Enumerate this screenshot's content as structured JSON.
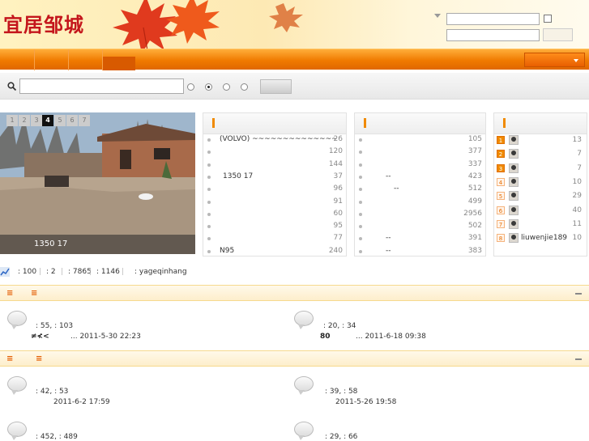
{
  "header": {
    "logo_text": "宜居邹城"
  },
  "slideshow": {
    "tabs": [
      "1",
      "2",
      "3",
      "4",
      "5",
      "6",
      "7"
    ],
    "active_tab": "4",
    "caption": "1350 17"
  },
  "panel1": {
    "rows": [
      {
        "t": "(VOLVO) ~~~~~~~~~~~~~~",
        "n": "26"
      },
      {
        "t": "",
        "n": "120"
      },
      {
        "t": "",
        "n": "144"
      },
      {
        "t": "1350 17",
        "n": "37"
      },
      {
        "t": "",
        "n": "96"
      },
      {
        "t": "",
        "n": "91"
      },
      {
        "t": "",
        "n": "60"
      },
      {
        "t": "",
        "n": "95"
      },
      {
        "t": "",
        "n": "77"
      },
      {
        "t": "N95",
        "n": "240"
      }
    ]
  },
  "panel2": {
    "rows": [
      {
        "t": "",
        "n": "105"
      },
      {
        "t": "",
        "n": "377"
      },
      {
        "t": "",
        "n": "337"
      },
      {
        "t": "--",
        "n": "423"
      },
      {
        "t": "--",
        "n": "512"
      },
      {
        "t": "",
        "n": "499"
      },
      {
        "t": "",
        "n": "2956"
      },
      {
        "t": "",
        "n": "502"
      },
      {
        "t": "--",
        "n": "391"
      },
      {
        "t": "--",
        "n": "383"
      }
    ]
  },
  "panel3": {
    "rows": [
      {
        "rank": "1",
        "name": "",
        "n": "13"
      },
      {
        "rank": "2",
        "name": "",
        "n": "7"
      },
      {
        "rank": "3",
        "name": "",
        "n": "7"
      },
      {
        "rank": "4",
        "name": "",
        "n": "10"
      },
      {
        "rank": "5",
        "name": "",
        "n": "29"
      },
      {
        "rank": "6",
        "name": "",
        "n": "40"
      },
      {
        "rank": "7",
        "name": "",
        "n": "11"
      },
      {
        "rank": "8",
        "name": "liuwenjie189",
        "n": "10"
      }
    ]
  },
  "stats": {
    "items": [
      ": 100",
      ": 2",
      ": 7865",
      ": 1146",
      ": yageqinhang"
    ]
  },
  "sections": [
    {
      "posts": [
        {
          "counts": ": 55,  : 103",
          "sub": "≠≮<",
          "date": "... 2011-5-30 22:23"
        },
        {
          "counts": ": 20,  : 34",
          "sub": "80",
          "date": "... 2011-6-18 09:38"
        }
      ]
    },
    {
      "posts": [
        {
          "counts": ": 42,  : 53",
          "sub": "",
          "date": "2011-6-2 17:59"
        },
        {
          "counts": ": 39,  : 58",
          "sub": "",
          "date": "2011-5-26 19:58"
        },
        {
          "counts": ": 452,  : 489",
          "sub": "",
          "date": ""
        },
        {
          "counts": ": 29,  : 66",
          "sub": "",
          "date": ""
        }
      ]
    }
  ],
  "colors": {
    "accent": "#f07a00",
    "logo": "#c4161c",
    "section_marker": "#e35b00"
  }
}
